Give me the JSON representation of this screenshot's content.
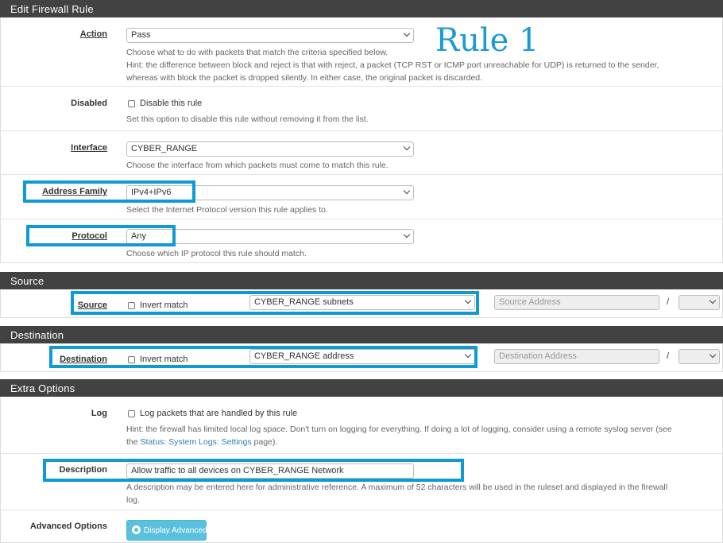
{
  "sections": {
    "edit": "Edit Firewall Rule",
    "source": "Source",
    "destination": "Destination",
    "extra": "Extra Options"
  },
  "overlay_title": "Rule 1",
  "action": {
    "label": "Action",
    "value": "Pass",
    "help1": "Choose what to do with packets that match the criteria specified below.",
    "help2": "Hint: the difference between block and reject is that with reject, a packet (TCP RST or ICMP port unreachable for UDP) is returned to the sender,",
    "help3": "whereas with block the packet is dropped silently. In either case, the original packet is discarded."
  },
  "disabled": {
    "label": "Disabled",
    "checkbox_label": "Disable this rule",
    "help": "Set this option to disable this rule without removing it from the list."
  },
  "interface": {
    "label": "Interface",
    "value": "CYBER_RANGE",
    "help": "Choose the interface from which packets must come to match this rule."
  },
  "address_family": {
    "label": "Address Family",
    "value": "IPv4+IPv6",
    "help": "Select the Internet Protocol version this rule applies to."
  },
  "protocol": {
    "label": "Protocol",
    "value": "Any",
    "help": "Choose which IP protocol this rule should match."
  },
  "source": {
    "label": "Source",
    "invert_label": "Invert match",
    "value": "CYBER_RANGE subnets",
    "address_placeholder": "Source Address",
    "slash": "/"
  },
  "destination": {
    "label": "Destination",
    "invert_label": "Invert match",
    "value": "CYBER_RANGE address",
    "address_placeholder": "Destination Address",
    "slash": "/"
  },
  "log": {
    "label": "Log",
    "checkbox_label": "Log packets that are handled by this rule",
    "help1": "Hint: the firewall has limited local log space. Don't turn on logging for everything. If doing a lot of logging, consider using a remote syslog server (see",
    "help2_pre": "the ",
    "help2_link": "Status: System Logs: Settings",
    "help2_post": " page)."
  },
  "description": {
    "label": "Description",
    "value": "Allow traffic to all devices on CYBER_RANGE Network",
    "help1": "A description may be entered here for administrative reference. A maximum of 52 characters will be used in the ruleset and displayed in the firewall",
    "help2": "log."
  },
  "advanced": {
    "label": "Advanced Options",
    "button": "Display Advanced"
  },
  "colors": {
    "highlight": "#0e9ad7",
    "heading_bg": "#424242",
    "button_info": "#5bc0de"
  }
}
